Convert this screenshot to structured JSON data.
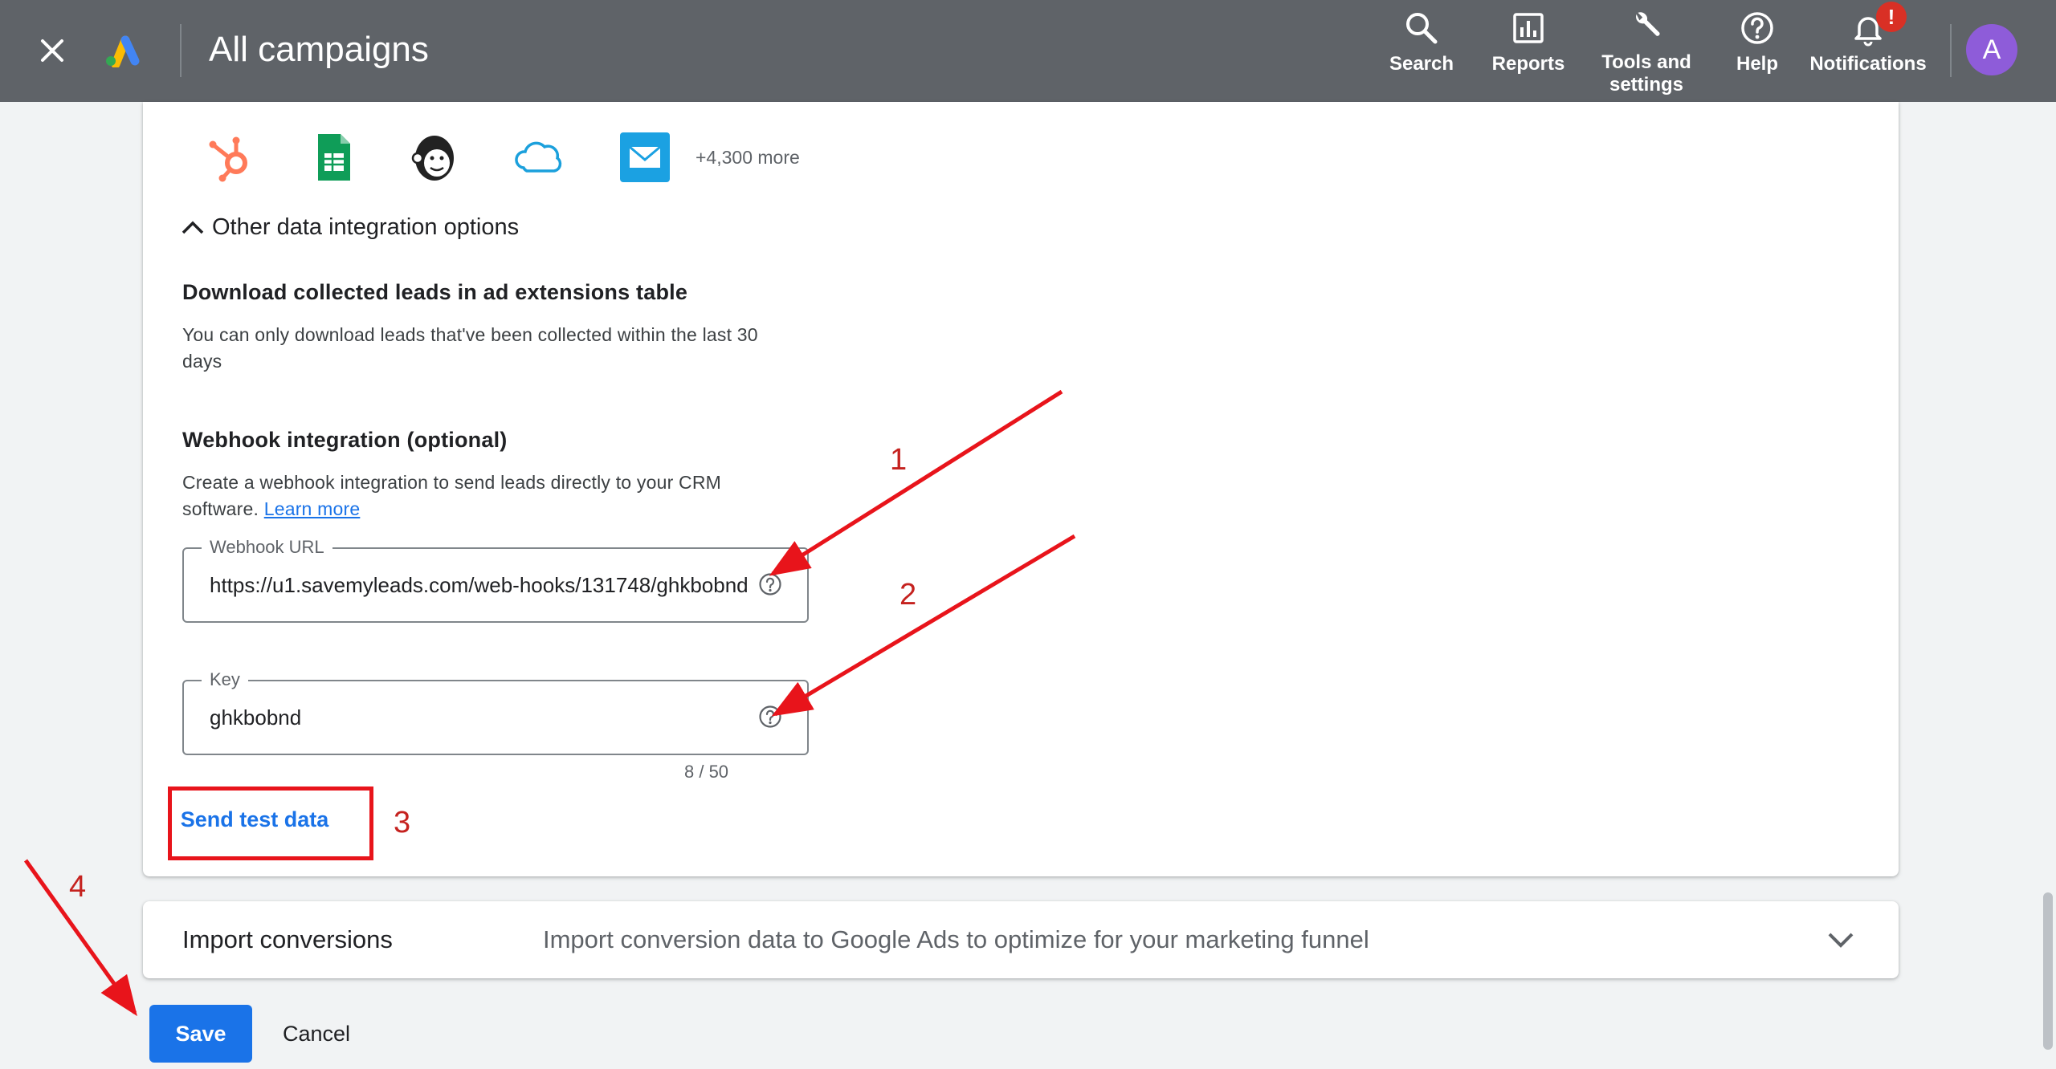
{
  "header": {
    "title": "All campaigns",
    "nav": [
      {
        "label": "Search",
        "icon": "search-icon"
      },
      {
        "label": "Reports",
        "icon": "reports-icon"
      },
      {
        "label": "Tools and\nsettings",
        "icon": "wrench-icon"
      },
      {
        "label": "Help",
        "icon": "help-icon"
      },
      {
        "label": "Notifications",
        "icon": "bell-icon",
        "badge": "!"
      }
    ],
    "avatar_letter": "A"
  },
  "integrations": {
    "apps": [
      "hubspot-icon",
      "google-sheets-icon",
      "mailchimp-icon",
      "salesforce-icon",
      "email-app-icon"
    ],
    "more_label": "+4,300 more"
  },
  "other_options": {
    "toggle_label": "Other data integration options",
    "download": {
      "title": "Download collected leads in ad extensions table",
      "desc": "You can only download leads that've been collected within the last 30 days"
    },
    "webhook": {
      "title": "Webhook integration (optional)",
      "desc": "Create a webhook integration to send leads directly to your CRM software.",
      "learn_more": "Learn more",
      "url_label": "Webhook URL",
      "url_value": "https://u1.savemyleads.com/web-hooks/131748/ghkbobnd",
      "key_label": "Key",
      "key_value": "ghkbobnd",
      "key_counter": "8 / 50",
      "send_test": "Send test data"
    }
  },
  "import_conversions": {
    "title": "Import conversions",
    "desc": "Import conversion data to Google Ads to optimize for your marketing funnel"
  },
  "actions": {
    "save": "Save",
    "cancel": "Cancel"
  },
  "annotations": [
    "1",
    "2",
    "3",
    "4"
  ],
  "colors": {
    "topbar": "#5f6368",
    "primary": "#1a73e8",
    "annotation": "#e8141b",
    "avatar": "#8e5cd9"
  }
}
